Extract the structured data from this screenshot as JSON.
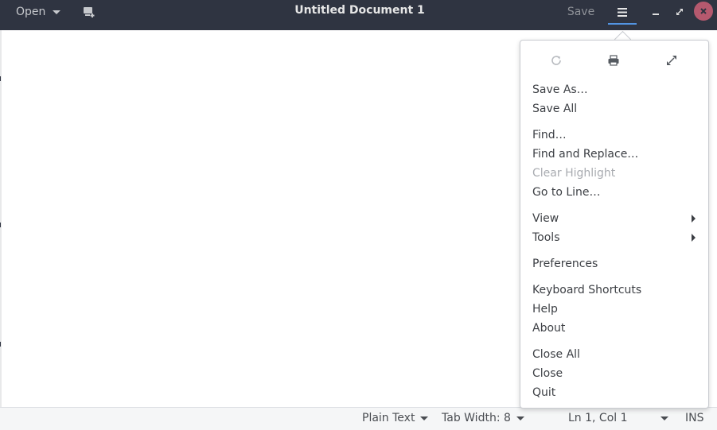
{
  "header": {
    "open_label": "Open",
    "title": "Untitled Document 1",
    "save_label": "Save"
  },
  "popover": {
    "icons": [
      "reload-icon",
      "print-icon",
      "fullscreen-icon"
    ],
    "items": {
      "save_as": "Save As…",
      "save_all": "Save All",
      "find": "Find…",
      "find_replace": "Find and Replace…",
      "clear_highlight": "Clear Highlight",
      "go_to_line": "Go to Line…",
      "view": "View",
      "tools": "Tools",
      "preferences": "Preferences",
      "keyboard_shortcuts": "Keyboard Shortcuts",
      "help": "Help",
      "about": "About",
      "close_all": "Close All",
      "close": "Close",
      "quit": "Quit"
    }
  },
  "statusbar": {
    "language": "Plain Text",
    "tab_width": "Tab Width: 8",
    "position": "Ln 1, Col 1",
    "mode": "INS"
  },
  "colors": {
    "headerbar": "#2f3441",
    "accent": "#5294e2",
    "close_button": "#b5596e",
    "disabled_text": "#a8abb0"
  }
}
